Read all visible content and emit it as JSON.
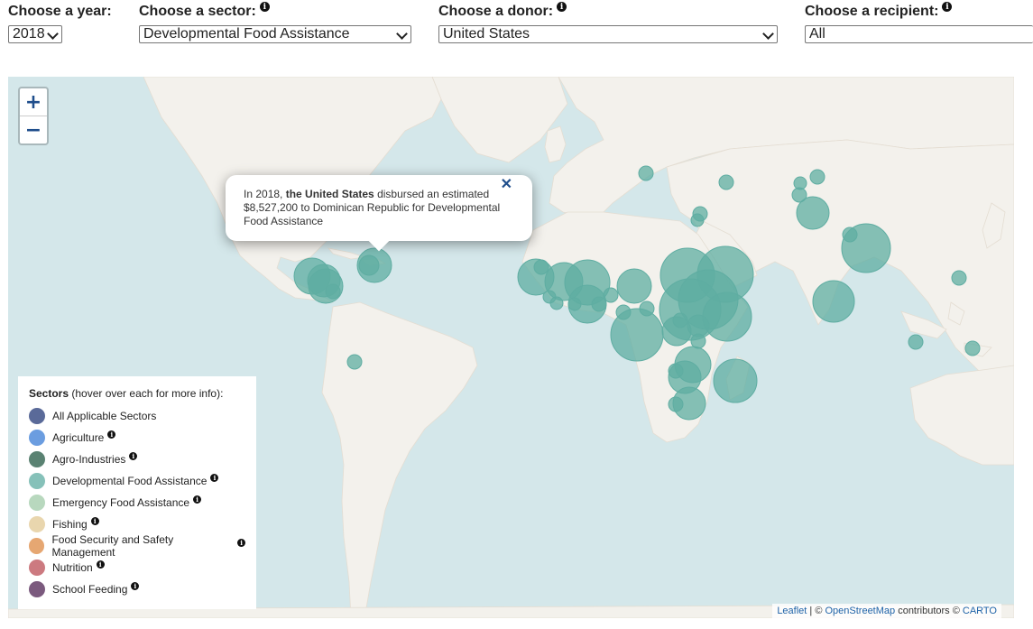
{
  "controls": {
    "year": {
      "label": "Choose a year:",
      "value": "2018"
    },
    "sector": {
      "label": "Choose a sector:",
      "value": "Developmental Food Assistance"
    },
    "donor": {
      "label": "Choose a donor:",
      "value": "United States"
    },
    "recipient": {
      "label": "Choose a recipient:",
      "value": "All"
    }
  },
  "map": {
    "zoom_in": "+",
    "zoom_out": "−",
    "marker_color": "#5fada2"
  },
  "popup": {
    "prefix": "In 2018, ",
    "bold": "the United States",
    "rest": " disbursed an estimated $8,527,200 to Dominican Republic for Developmental Food Assistance",
    "close": "✕"
  },
  "legend": {
    "title_bold": "Sectors",
    "title_rest": " (hover over each for more info):",
    "items": [
      {
        "label": "All Applicable Sectors",
        "color": "#5a6a99",
        "info": false
      },
      {
        "label": "Agriculture",
        "color": "#6b9de0",
        "info": true
      },
      {
        "label": "Agro-Industries",
        "color": "#5a8272",
        "info": true
      },
      {
        "label": "Developmental Food Assistance",
        "color": "#86c1b9",
        "info": true
      },
      {
        "label": "Emergency Food Assistance",
        "color": "#b8d8be",
        "info": true
      },
      {
        "label": "Fishing",
        "color": "#e9d6ae",
        "info": true
      },
      {
        "label": "Food Security and Safety Management",
        "color": "#e6a772",
        "info": true
      },
      {
        "label": "Nutrition",
        "color": "#cc7a80",
        "info": true
      },
      {
        "label": "School Feeding",
        "color": "#7b5a7e",
        "info": true
      }
    ]
  },
  "attribution": {
    "leaflet": "Leaflet",
    "sep": " | © ",
    "osm": "OpenStreetMap",
    "contrib": " contributors © ",
    "carto": "CARTO"
  }
}
